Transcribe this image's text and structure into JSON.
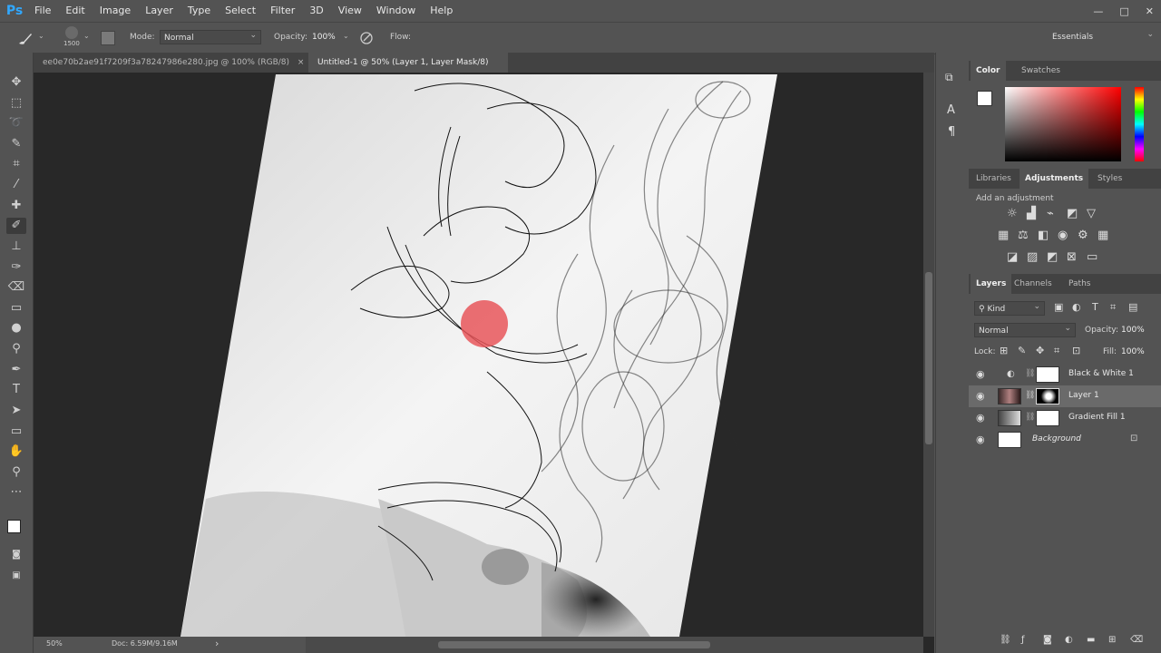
{
  "app": {
    "logo": "Ps"
  },
  "menu": [
    "File",
    "Edit",
    "Image",
    "Layer",
    "Type",
    "Select",
    "Filter",
    "3D",
    "View",
    "Window",
    "Help"
  ],
  "window_controls": {
    "minimize": "—",
    "maximize": "□",
    "close": "✕"
  },
  "options": {
    "brush_size": "1500",
    "mode_label": "Mode:",
    "mode_value": "Normal",
    "opacity_label": "Opacity:",
    "opacity_value": "100%",
    "flow_label": "Flow:",
    "workspace": "Essentials"
  },
  "doc_tabs": [
    {
      "label": "ee0e70b2ae91f7209f3a78247986e280.jpg @ 100% (RGB/8)",
      "close": "×"
    },
    {
      "label": "Untitled-1 @ 50% (Layer 1, Layer Mask/8)",
      "close": "×"
    }
  ],
  "status": {
    "zoom": "50%",
    "doc": "Doc: 6.59M/9.16M",
    "arrow": "›"
  },
  "color_panel": {
    "tabs": [
      "Color",
      "Swatches"
    ]
  },
  "adjustments_panel": {
    "tabs": [
      "Libraries",
      "Adjustments",
      "Styles"
    ],
    "add_label": "Add an adjustment"
  },
  "layers_panel": {
    "tabs": [
      "Layers",
      "Channels",
      "Paths"
    ],
    "filter_label": "Kind",
    "blend_mode": "Normal",
    "opacity_label": "Opacity:",
    "opacity_value": "100%",
    "lock_label": "Lock:",
    "fill_label": "Fill:",
    "fill_value": "100%",
    "layers": [
      {
        "name": "Black & White 1",
        "selected": false
      },
      {
        "name": "Layer 1",
        "selected": true
      },
      {
        "name": "Gradient Fill 1",
        "selected": false
      },
      {
        "name": "Background",
        "selected": false
      }
    ]
  },
  "colors": {
    "accent": "#31a8ff",
    "cursor_dot": "#e8565b",
    "panel_bg": "#535353",
    "canvas_bg": "#282828"
  }
}
